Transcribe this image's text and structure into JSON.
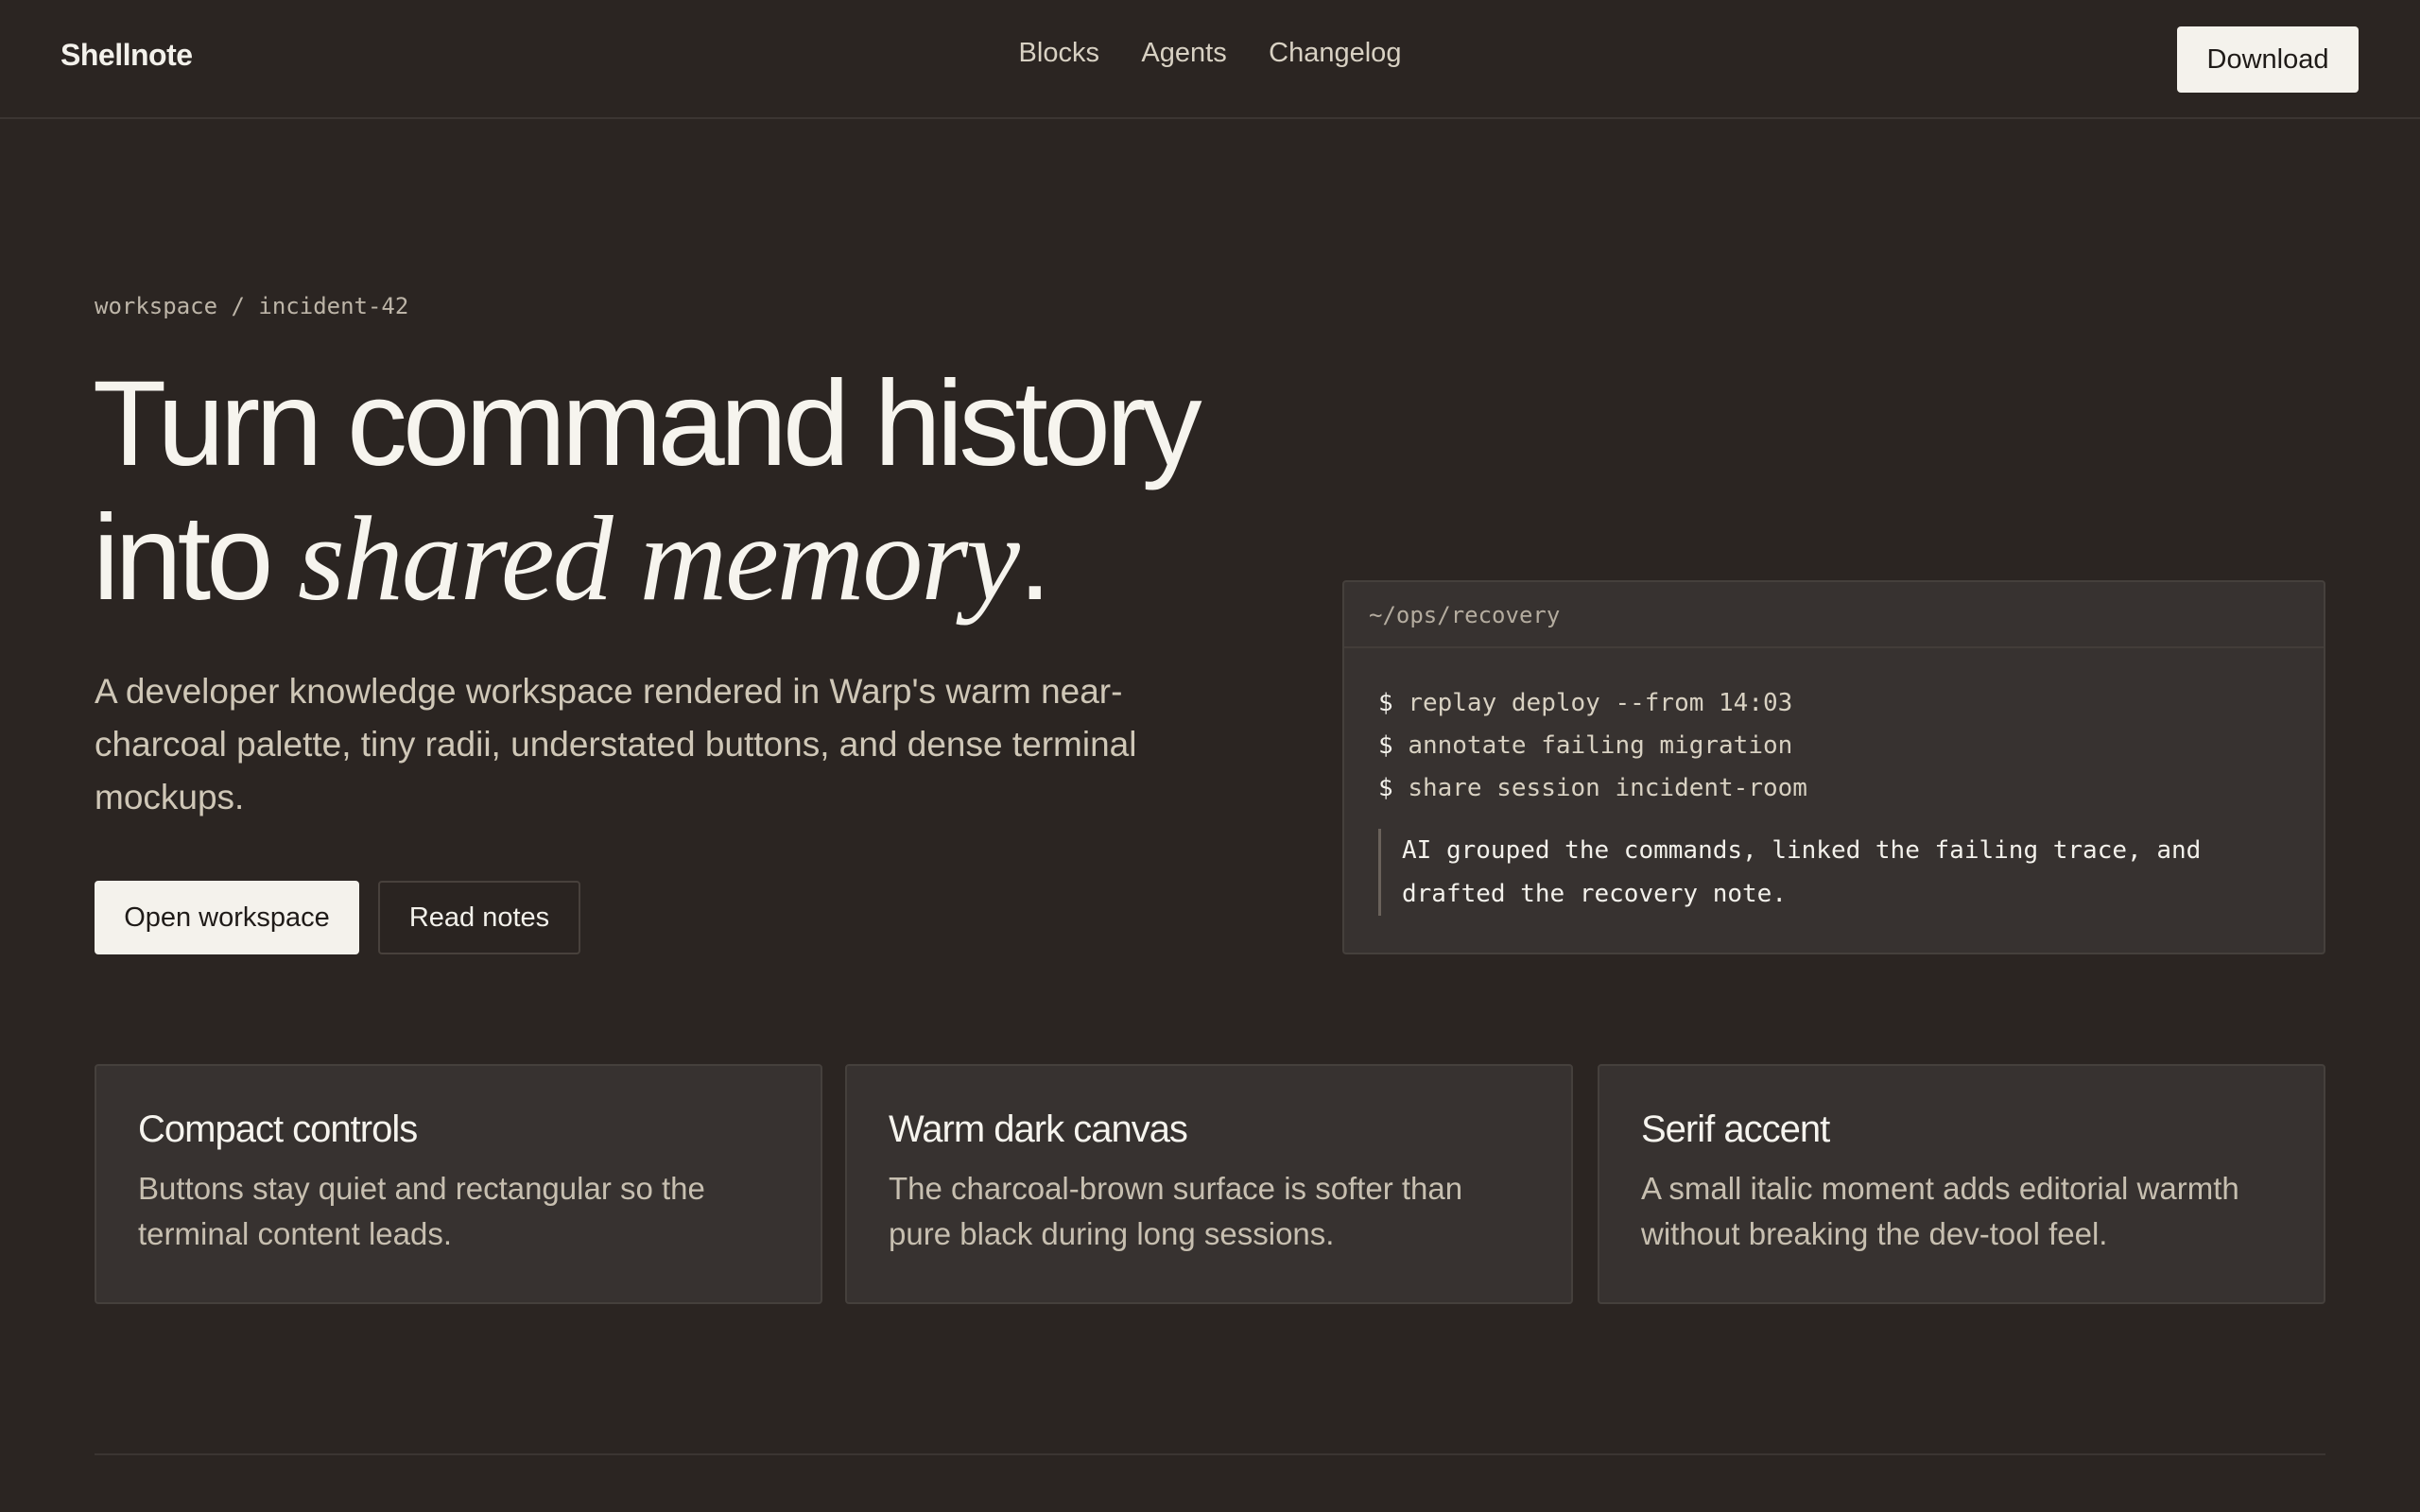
{
  "header": {
    "brand": "Shellnote",
    "nav": [
      "Blocks",
      "Agents",
      "Changelog"
    ],
    "download_label": "Download"
  },
  "hero": {
    "breadcrumb": "workspace / incident-42",
    "headline_line1": "Turn command history",
    "headline_line2_prefix": "into ",
    "headline_accent": "shared memory",
    "headline_suffix": ".",
    "lede": "A developer knowledge workspace rendered in Warp's warm near-charcoal palette, tiny radii, understated buttons, and dense terminal mockups.",
    "primary_label": "Open workspace",
    "secondary_label": "Read notes"
  },
  "terminal": {
    "path": "~/ops/recovery",
    "prompt": "$",
    "commands": [
      "replay deploy --from 14:03",
      "annotate failing migration",
      "share session incident-room"
    ],
    "note": "AI grouped the commands, linked the failing trace, and drafted the recovery note."
  },
  "features": [
    {
      "title": "Compact controls",
      "body": "Buttons stay quiet and rectangular so the terminal content leads."
    },
    {
      "title": "Warm dark canvas",
      "body": "The charcoal-brown surface is softer than pure black during long sessions."
    },
    {
      "title": "Serif accent",
      "body": "A small italic moment adds editorial warmth without breaking the dev-tool feel."
    }
  ],
  "colors": {
    "background": "#2b2522",
    "surface": "#373230",
    "text": "#f3f1eb",
    "muted": "#cfc7b7",
    "button_light": "#f4f2ec"
  }
}
